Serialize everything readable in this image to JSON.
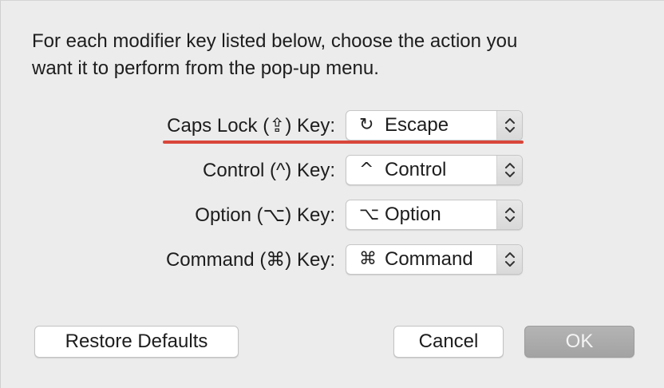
{
  "instructions": {
    "line1": "For each modifier key listed below, choose the action you",
    "line2": "want it to perform from the pop-up menu."
  },
  "rows": [
    {
      "label": "Caps Lock (⇪) Key:",
      "glyph": "↻",
      "value": "Escape",
      "icon": "escape-icon"
    },
    {
      "label": "Control (^) Key:",
      "glyph": "^",
      "value": "Control",
      "icon": "control-icon"
    },
    {
      "label": "Option (⌥) Key:",
      "glyph": "⌥",
      "value": "Option",
      "icon": "option-icon"
    },
    {
      "label": "Command (⌘) Key:",
      "glyph": "⌘",
      "value": "Command",
      "icon": "command-icon"
    }
  ],
  "buttons": {
    "restore": "Restore Defaults",
    "cancel": "Cancel",
    "ok": "OK"
  },
  "colors": {
    "annotation_underline": "#d9463b",
    "ok_button": "#a9a9a9",
    "background": "#ececec"
  }
}
